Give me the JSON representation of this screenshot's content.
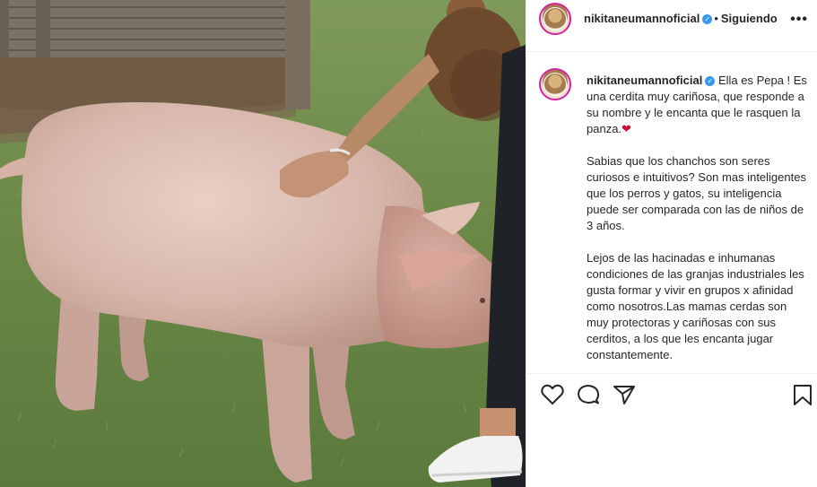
{
  "post": {
    "username": "nikitaneumannoficial",
    "follow_status": "Siguiendo",
    "separator": "•",
    "verified_glyph": "✓",
    "more_glyph": "•••",
    "caption_paragraphs": [
      "Ella es Pepa ! Es una cerdita muy cariñosa, que responde a su nombre y le encanta que le rasquen la panza.",
      "Sabias que los chanchos son seres curiosos e intuitivos? Son mas inteligentes que los perros y gatos, su inteligencia puede ser comparada con las de niños de 3 años.",
      "Lejos de las hacinadas e inhumanas condiciones de las granjas industriales les gusta formar y vivir en grupos x afinidad como nosotros.Las mamas cerdas son muy protectoras y cariñosas con sus cerditos, a los que les encanta jugar constantemente."
    ],
    "caption_emoji": "❤"
  },
  "icons": {
    "like": "heart-outline-icon",
    "comment": "comment-bubble-icon",
    "share": "paper-plane-icon",
    "save": "bookmark-icon",
    "more": "more-dots-icon"
  },
  "colors": {
    "text": "#262626",
    "verified": "#3897f0",
    "divider": "#efefef",
    "avatar_ring": "#d6249f"
  }
}
